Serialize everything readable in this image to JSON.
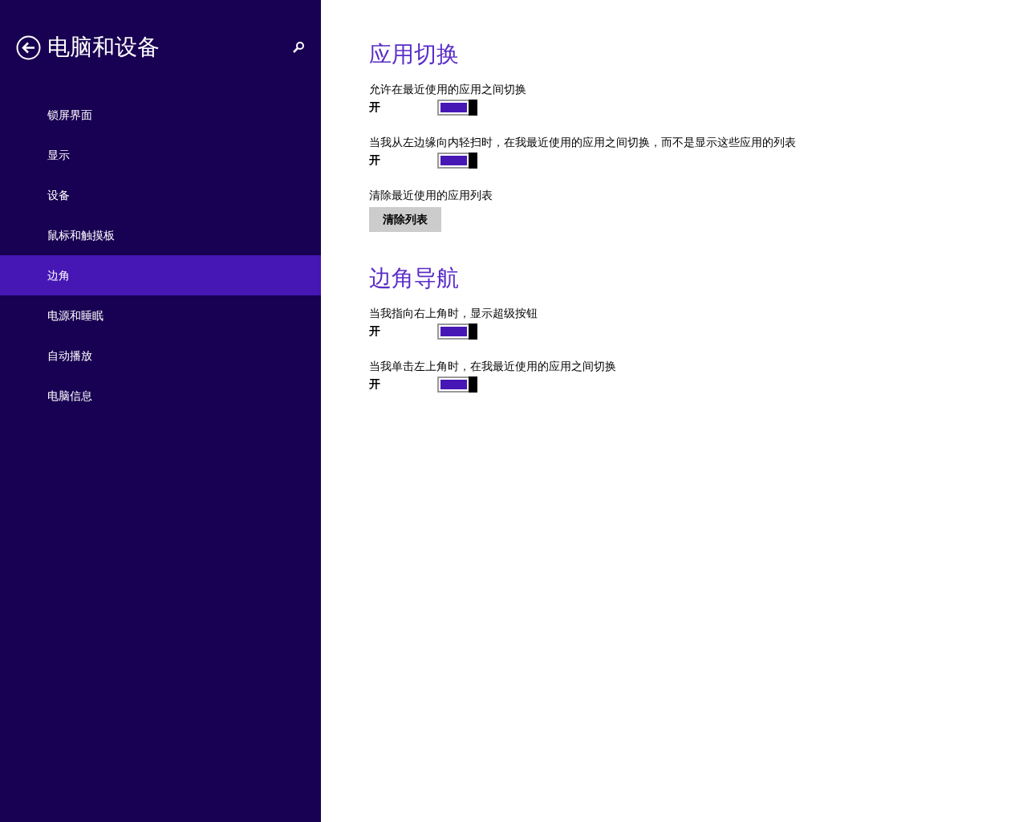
{
  "sidebar": {
    "title": "电脑和设备",
    "items": [
      {
        "label": "锁屏界面",
        "selected": false
      },
      {
        "label": "显示",
        "selected": false
      },
      {
        "label": "设备",
        "selected": false
      },
      {
        "label": "鼠标和触摸板",
        "selected": false
      },
      {
        "label": "边角",
        "selected": true
      },
      {
        "label": "电源和睡眠",
        "selected": false
      },
      {
        "label": "自动播放",
        "selected": false
      },
      {
        "label": "电脑信息",
        "selected": false
      }
    ]
  },
  "sections": [
    {
      "heading": "应用切换",
      "settings": [
        {
          "kind": "toggle",
          "label": "允许在最近使用的应用之间切换",
          "state_text": "开",
          "on": true
        },
        {
          "kind": "toggle",
          "label": "当我从左边缘向内轻扫时，在我最近使用的应用之间切换，而不是显示这些应用的列表",
          "state_text": "开",
          "on": true
        },
        {
          "kind": "button",
          "label": "清除最近使用的应用列表",
          "button": "清除列表"
        }
      ]
    },
    {
      "heading": "边角导航",
      "settings": [
        {
          "kind": "toggle",
          "label": "当我指向右上角时，显示超级按钮",
          "state_text": "开",
          "on": true
        },
        {
          "kind": "toggle",
          "label": "当我单击左上角时，在我最近使用的应用之间切换",
          "state_text": "开",
          "on": true
        }
      ]
    }
  ]
}
